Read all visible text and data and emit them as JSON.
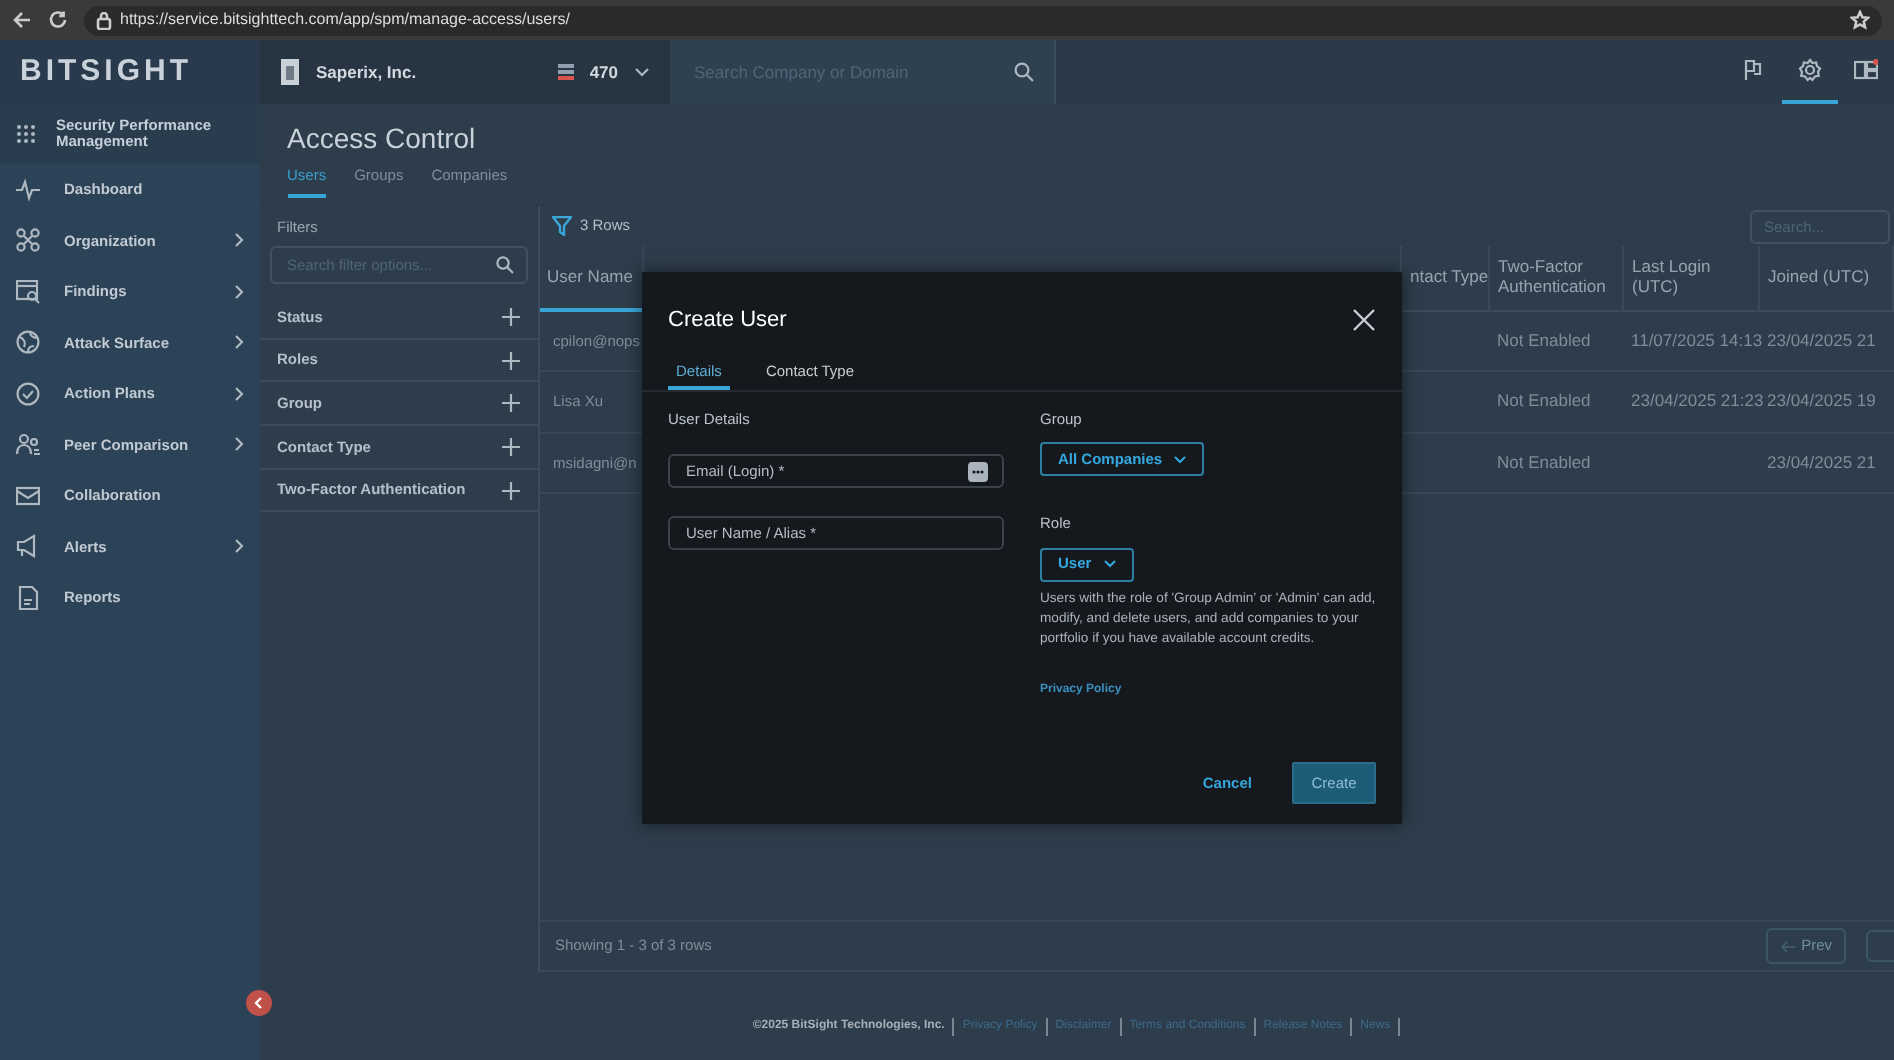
{
  "browser": {
    "url": "https://service.bitsighttech.com/app/spm/manage-access/users/"
  },
  "header": {
    "logo": "BITSIGHT",
    "company": "Saperix, Inc.",
    "rating": "470",
    "search": {
      "placeholder": "Search Company or Domain"
    },
    "tools": [
      {
        "kind": "flag",
        "selected": false
      },
      {
        "kind": "gear",
        "selected": true
      },
      {
        "kind": "dashboard",
        "selected": false
      }
    ]
  },
  "sidebar": {
    "product": "Security Performance Management",
    "items": [
      {
        "kind": "pulse",
        "label": "Dashboard",
        "expandable": false
      },
      {
        "kind": "org",
        "label": "Organization",
        "expandable": true
      },
      {
        "kind": "findings",
        "label": "Findings",
        "expandable": true
      },
      {
        "kind": "globe",
        "label": "Attack Surface",
        "expandable": true
      },
      {
        "kind": "check",
        "label": "Action Plans",
        "expandable": true
      },
      {
        "kind": "people",
        "label": "Peer Comparison",
        "expandable": true
      },
      {
        "kind": "mail",
        "label": "Collaboration",
        "expandable": false
      },
      {
        "kind": "megaphone",
        "label": "Alerts",
        "expandable": true
      },
      {
        "kind": "report",
        "label": "Reports",
        "expandable": false
      }
    ]
  },
  "page": {
    "title": "Access Control",
    "tabs": [
      {
        "label": "Users",
        "selected": true
      },
      {
        "label": "Groups",
        "selected": false
      },
      {
        "label": "Companies",
        "selected": false
      }
    ],
    "filters": {
      "title": "Filters",
      "search": {
        "placeholder": "Search filter options..."
      },
      "groups": [
        "Status",
        "Roles",
        "Group",
        "Contact Type",
        "Two-Factor Authentication"
      ]
    },
    "table": {
      "row_count": "3 Rows",
      "search": {
        "placeholder": "Search..."
      },
      "columns": [
        "User Name",
        "ntact Type",
        "Two-Factor Authentication",
        "Last Login (UTC)",
        "Joined (UTC)"
      ],
      "rows": [
        {
          "user": "cpilon@nops",
          "two_factor": "Not Enabled",
          "last_login": "11/07/2025 14:13",
          "joined": "23/04/2025 21"
        },
        {
          "user": "Lisa Xu",
          "two_factor": "Not Enabled",
          "last_login": "23/04/2025 21:23",
          "joined": "23/04/2025 19"
        },
        {
          "user": "msidagni@n",
          "two_factor": "Not Enabled",
          "joined": "23/04/2025 21"
        }
      ],
      "summary": "Showing 1 - 3 of 3 rows",
      "prev": "Prev"
    }
  },
  "footer": {
    "copyright": "©2025 BitSight Technologies, Inc.",
    "links": [
      "Privacy Policy",
      "Disclaimer",
      "Terms and Conditions",
      "Release Notes",
      "News"
    ]
  },
  "modal": {
    "title": "Create User",
    "tabs": [
      {
        "label": "Details",
        "selected": true
      },
      {
        "label": "Contact Type",
        "selected": false
      }
    ],
    "section": "User Details",
    "fields": [
      {
        "placeholder": "Email (Login) *"
      },
      {
        "placeholder": "User Name / Alias *"
      }
    ],
    "group": {
      "label": "Group",
      "value": "All Companies"
    },
    "role": {
      "label": "Role",
      "value": "User"
    },
    "help": "Users with the role of 'Group Admin' or 'Admin' can add, modify, and delete users, and add companies to your portfolio if you have available account credits.",
    "privacy": "Privacy Policy",
    "buttons": {
      "cancel": "Cancel",
      "create": "Create"
    }
  }
}
